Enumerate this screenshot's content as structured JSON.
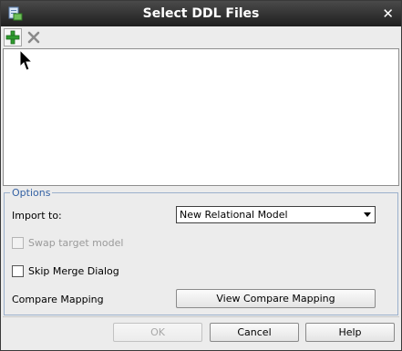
{
  "window": {
    "title": "Select DDL Files"
  },
  "toolbar": {
    "add_icon": "plus-icon",
    "remove_icon": "delete-icon"
  },
  "options": {
    "legend": "Options",
    "import_to_label": "Import to:",
    "import_to_value": "New Relational Model",
    "swap_label": "Swap target model",
    "swap_checked": false,
    "swap_enabled": false,
    "skip_merge_label": "Skip Merge Dialog",
    "skip_merge_checked": false,
    "compare_mapping_label": "Compare Mapping",
    "view_compare_button": "View Compare Mapping"
  },
  "buttons": {
    "ok": "OK",
    "cancel": "Cancel",
    "help": "Help"
  },
  "colors": {
    "titlebar": "#2b2b2b",
    "legend": "#3462a4",
    "add_icon": "#2e9b2e",
    "remove_icon": "#8a8a8a"
  }
}
